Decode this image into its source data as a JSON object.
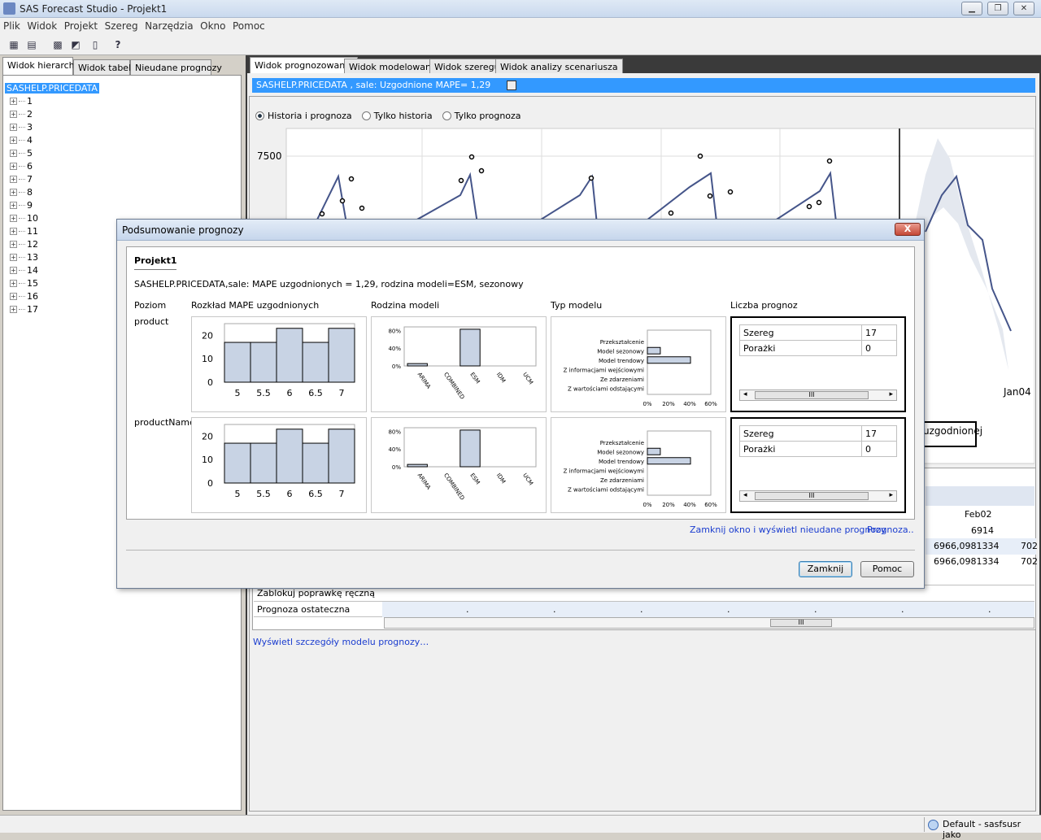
{
  "window": {
    "title": "SAS Forecast Studio - Projekt1",
    "min": "▁",
    "max": "❐",
    "close": "✕"
  },
  "menu": [
    "Plik",
    "Widok",
    "Projekt",
    "Szereg",
    "Narzędzia",
    "Okno",
    "Pomoc"
  ],
  "left_tabs": [
    "Widok hierarchii",
    "Widok tabeli",
    "Nieudane prognozy"
  ],
  "tree": {
    "root": "SASHELP.PRICEDATA",
    "items": [
      "1",
      "2",
      "3",
      "4",
      "5",
      "6",
      "7",
      "8",
      "9",
      "10",
      "11",
      "12",
      "13",
      "14",
      "15",
      "16",
      "17"
    ]
  },
  "right_tabs": [
    "Widok prognozowania",
    "Widok modelowania",
    "Widok szeregu",
    "Widok analizy scenariusza"
  ],
  "series_bar": "SASHELP.PRICEDATA , sale: Uzgodnione MAPE=  1,29",
  "radios": [
    "Historia i prognoza",
    "Tylko historia",
    "Tylko prognoza"
  ],
  "main_chart": {
    "y_tick": "7500",
    "x_tick": "Jan04",
    "legend_fragment": "uzgodnionej"
  },
  "table_frag": {
    "header": "Feb02",
    "r1": "6914",
    "r2": "6966,0981334",
    "r2b": "702",
    "r3": "6966,0981334",
    "r3b": "702",
    "row_lock": "Zablokuj poprawkę ręczną",
    "row_final": "Prognoza ostateczna",
    "dot": "."
  },
  "detail_link": "Wyświetl szczegóły modelu prognozy…",
  "status": {
    "text": "Default - sasfsusr jako"
  },
  "dialog": {
    "title": "Podsumowanie prognozy",
    "close": "X",
    "project": "Projekt1",
    "summary": "SASHELP.PRICEDATA,sale: MAPE uzgodnionych =    1,29, rodzina modeli=ESM, sezonowy",
    "col_headers": [
      "Poziom",
      "Rozkład MAPE uzgodnionych",
      "Rodzina modeli",
      "Typ modelu",
      "Liczba prognoz"
    ],
    "levels": [
      "product",
      "productName"
    ],
    "link_close": "Zamknij okno i wyświetl nieudane prognozy",
    "link_prog": "Prognoza..",
    "btn_close": "Zamknij",
    "btn_help": "Pomoc",
    "count_rows": [
      {
        "label": "Szereg",
        "value": "17"
      },
      {
        "label": "Porażki",
        "value": "0"
      }
    ],
    "scroll_grip": "III"
  },
  "chart_data": [
    {
      "type": "bar",
      "title": "Rozkład MAPE uzgodnionych",
      "level": "product",
      "categories": [
        "5",
        "5.5",
        "6",
        "6.5",
        "7"
      ],
      "values": [
        17,
        17,
        23,
        17,
        23
      ],
      "ylim": [
        0,
        25
      ],
      "yticks": [
        "0",
        "10",
        "20"
      ]
    },
    {
      "type": "bar",
      "title": "Rodzina modeli",
      "level": "product",
      "categories": [
        "ARIMA",
        "COMBINED",
        "ESM",
        "IDM",
        "UCM"
      ],
      "values": [
        0.06,
        0,
        0.94,
        0,
        0
      ],
      "ylim": [
        0,
        1
      ],
      "yticks": [
        "0%",
        "40%",
        "80%"
      ]
    },
    {
      "type": "bar",
      "title": "Typ modelu",
      "level": "product",
      "orientation": "horizontal",
      "categories": [
        "Przekształcenie",
        "Model sezonowy",
        "Model trendowy",
        "Z informacjami wejściowymi",
        "Ze zdarzeniami",
        "Z wartościami odstającymi"
      ],
      "values": [
        0,
        0.18,
        0.88,
        0,
        0,
        0
      ],
      "xlim": [
        0,
        0.6
      ],
      "xticks": [
        "0%",
        "20%",
        "40%",
        "60%"
      ]
    },
    {
      "type": "bar",
      "title": "Rozkład MAPE uzgodnionych",
      "level": "productName",
      "categories": [
        "5",
        "5.5",
        "6",
        "6.5",
        "7"
      ],
      "values": [
        17,
        17,
        23,
        17,
        23
      ],
      "ylim": [
        0,
        25
      ],
      "yticks": [
        "0",
        "10",
        "20"
      ]
    },
    {
      "type": "bar",
      "title": "Rodzina modeli",
      "level": "productName",
      "categories": [
        "ARIMA",
        "COMBINED",
        "ESM",
        "IDM",
        "UCM"
      ],
      "values": [
        0.06,
        0,
        0.94,
        0,
        0
      ],
      "ylim": [
        0,
        1
      ],
      "yticks": [
        "0%",
        "40%",
        "80%"
      ]
    },
    {
      "type": "bar",
      "title": "Typ modelu",
      "level": "productName",
      "orientation": "horizontal",
      "categories": [
        "Przekształcenie",
        "Model sezonowy",
        "Model trendowy",
        "Z informacjami wejściowymi",
        "Ze zdarzeniami",
        "Z wartościami odstającymi"
      ],
      "values": [
        0,
        0.18,
        0.88,
        0,
        0,
        0
      ],
      "xlim": [
        0,
        0.6
      ],
      "xticks": [
        "0%",
        "20%",
        "40%",
        "60%"
      ]
    }
  ],
  "colors": {
    "bar_fill": "#c8d3e4",
    "selection": "#3399ff",
    "link": "#1a3ccf",
    "line": "#45558a"
  }
}
